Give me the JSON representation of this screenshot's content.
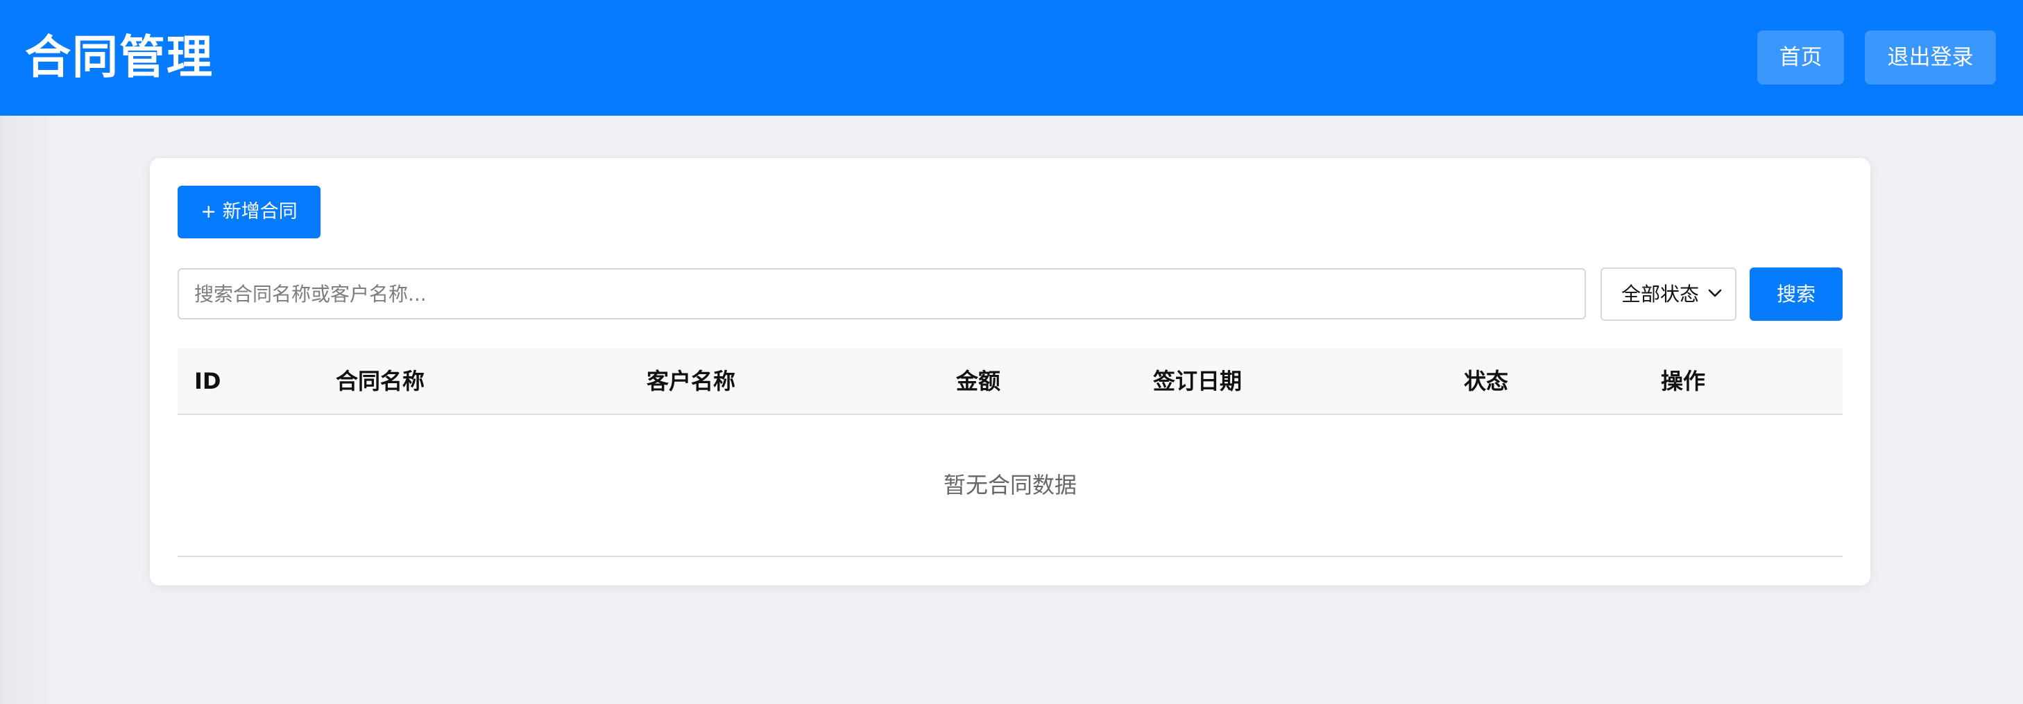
{
  "header": {
    "title": "合同管理",
    "home_label": "首页",
    "logout_label": "退出登录",
    "bg_color": "#077bfe"
  },
  "toolbar": {
    "add_label": "+ 新增合同"
  },
  "search": {
    "placeholder": "搜索合同名称或客户名称...",
    "value": "",
    "status_selected": "全部状态",
    "button_label": "搜索"
  },
  "table": {
    "columns": [
      "ID",
      "合同名称",
      "客户名称",
      "金额",
      "签订日期",
      "状态",
      "操作"
    ],
    "empty_text": "暂无合同数据"
  },
  "colors": {
    "primary": "#077bfe",
    "page_bg": "#eff1f4"
  }
}
